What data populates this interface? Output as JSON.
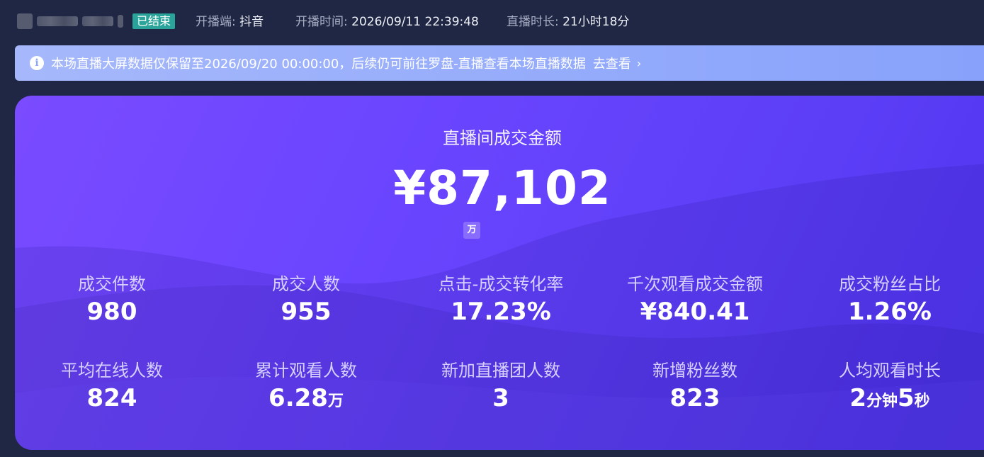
{
  "header": {
    "status_badge": "已结束",
    "platform_label": "开播端:",
    "platform_value": "抖音",
    "start_time_label": "开播时间:",
    "start_time_value": "2026/09/11 22:39:48",
    "duration_label": "直播时长:",
    "duration_value": "21小时18分"
  },
  "notice": {
    "text": "本场直播大屏数据仅保留至2026/09/20 00:00:00，后续仍可前往罗盘-直播查看本场直播数据",
    "link": "去查看",
    "icon": "info-icon",
    "chevron": "chevron-right-icon"
  },
  "hero": {
    "title": "直播间成交金额",
    "value": "¥87,102",
    "unit_toggle": "万"
  },
  "metrics": [
    {
      "label": "成交件数",
      "value": "980"
    },
    {
      "label": "成交人数",
      "value": "955"
    },
    {
      "label": "点击-成交转化率",
      "value": "17.23%"
    },
    {
      "label": "千次观看成交金额",
      "value": "¥840.41"
    },
    {
      "label": "成交粉丝占比",
      "value": "1.26%"
    },
    {
      "label": "平均在线人数",
      "value": "824"
    },
    {
      "label": "累计观看人数",
      "value": "6.28",
      "unit": "万"
    },
    {
      "label": "新加直播团人数",
      "value": "3"
    },
    {
      "label": "新增粉丝数",
      "value": "823"
    },
    {
      "label": "人均观看时长",
      "value_min": "2",
      "unit_min": "分钟",
      "value_sec": "5",
      "unit_sec": "秒"
    }
  ],
  "colors": {
    "page_bg": "#1f2744",
    "badge": "#2aa39a",
    "notice_bg": "#94abfb",
    "card_start": "#7a4bff",
    "card_end": "#4f35ef"
  }
}
